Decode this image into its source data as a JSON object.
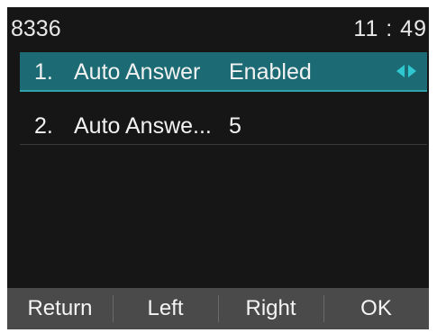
{
  "status": {
    "extension": "8336",
    "time": "11 : 49"
  },
  "menu": {
    "items": [
      {
        "index": "1.",
        "label": "Auto Answer",
        "value": "Enabled",
        "selected": true
      },
      {
        "index": "2.",
        "label": "Auto Answe...",
        "value": "5",
        "selected": false
      }
    ]
  },
  "softkeys": {
    "return_label": "Return",
    "left_label": "Left",
    "right_label": "Right",
    "ok_label": "OK"
  },
  "colors": {
    "selection": "#1c6b74",
    "arrow_accent": "#2fc8d0",
    "softkey_bar": "#4a4a4a",
    "screen_bg": "#161616"
  },
  "icons": {
    "selector_arrows": "left-right-arrows-icon"
  }
}
